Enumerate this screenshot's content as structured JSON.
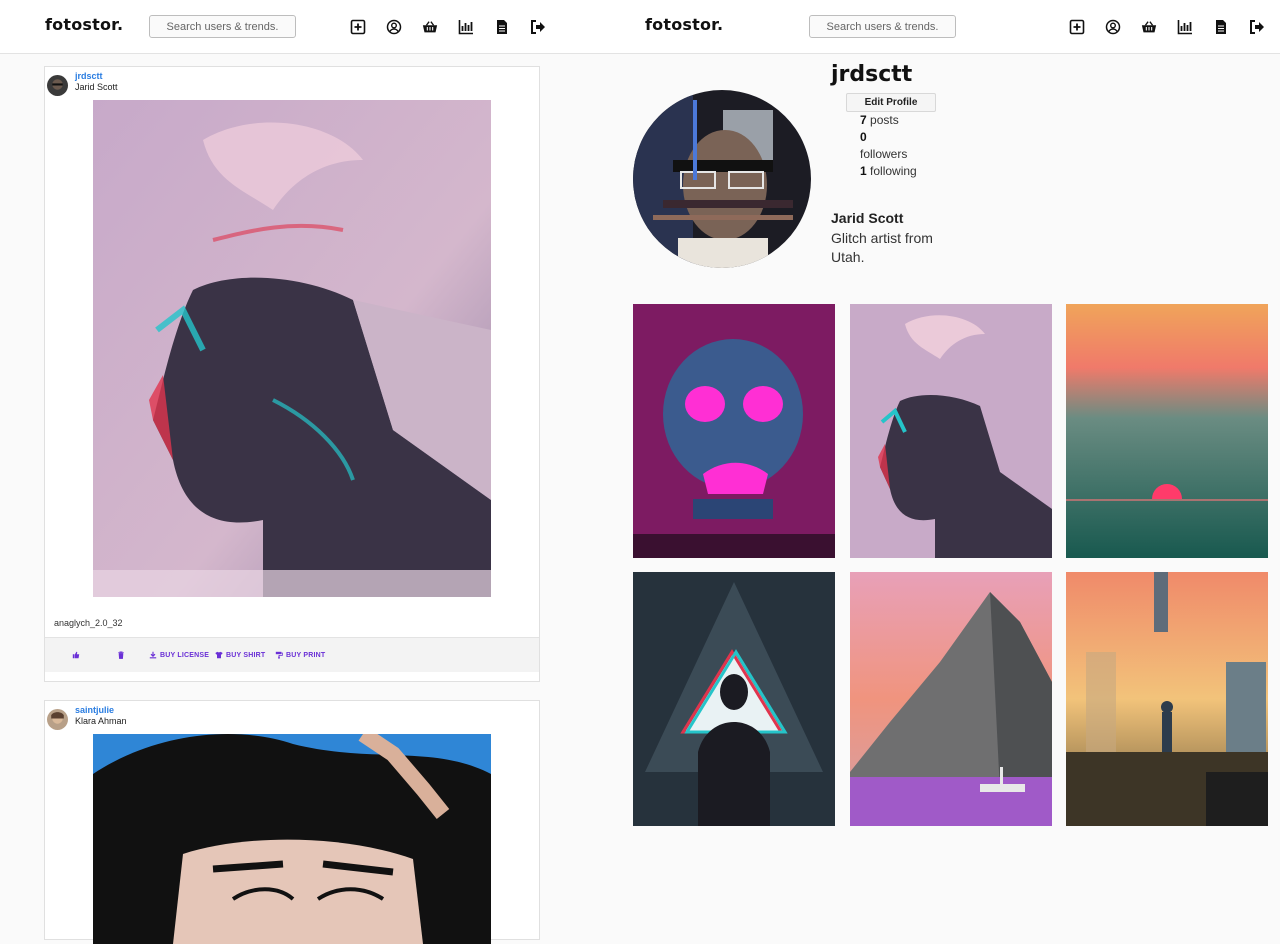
{
  "left_header": {
    "logo": "fotostor.",
    "search_placeholder": "Search users & trends."
  },
  "right_header": {
    "logo": "fotostor.",
    "search_placeholder": "Search users & trends."
  },
  "nav_icons": [
    "add-post-icon",
    "account-icon",
    "basket-icon",
    "analytics-icon",
    "document-icon",
    "logout-icon"
  ],
  "feed": {
    "posts": [
      {
        "username": "jrdsctt",
        "fullname": "Jarid Scott",
        "caption": "anaglych_2.0_32",
        "actions": {
          "like_icon": "thumbs-up-icon",
          "delete_icon": "trash-icon",
          "buy_license": "BUY LICENSE",
          "buy_shirt": "BUY SHIRT",
          "buy_print": "BUY PRINT"
        }
      },
      {
        "username": "saintjulie",
        "fullname": "Klara Ahman"
      }
    ]
  },
  "profile": {
    "username": "jrdsctt",
    "edit_label": "Edit Profile",
    "posts_count": "7",
    "posts_label": "posts",
    "followers_count": "0",
    "followers_label": "followers",
    "following_count": "1",
    "following_label": "following",
    "fullname": "Jarid Scott",
    "bio": "Glitch artist from Utah."
  },
  "colors": {
    "link_blue": "#2a7de1",
    "action_purple": "#6a2fd6"
  }
}
